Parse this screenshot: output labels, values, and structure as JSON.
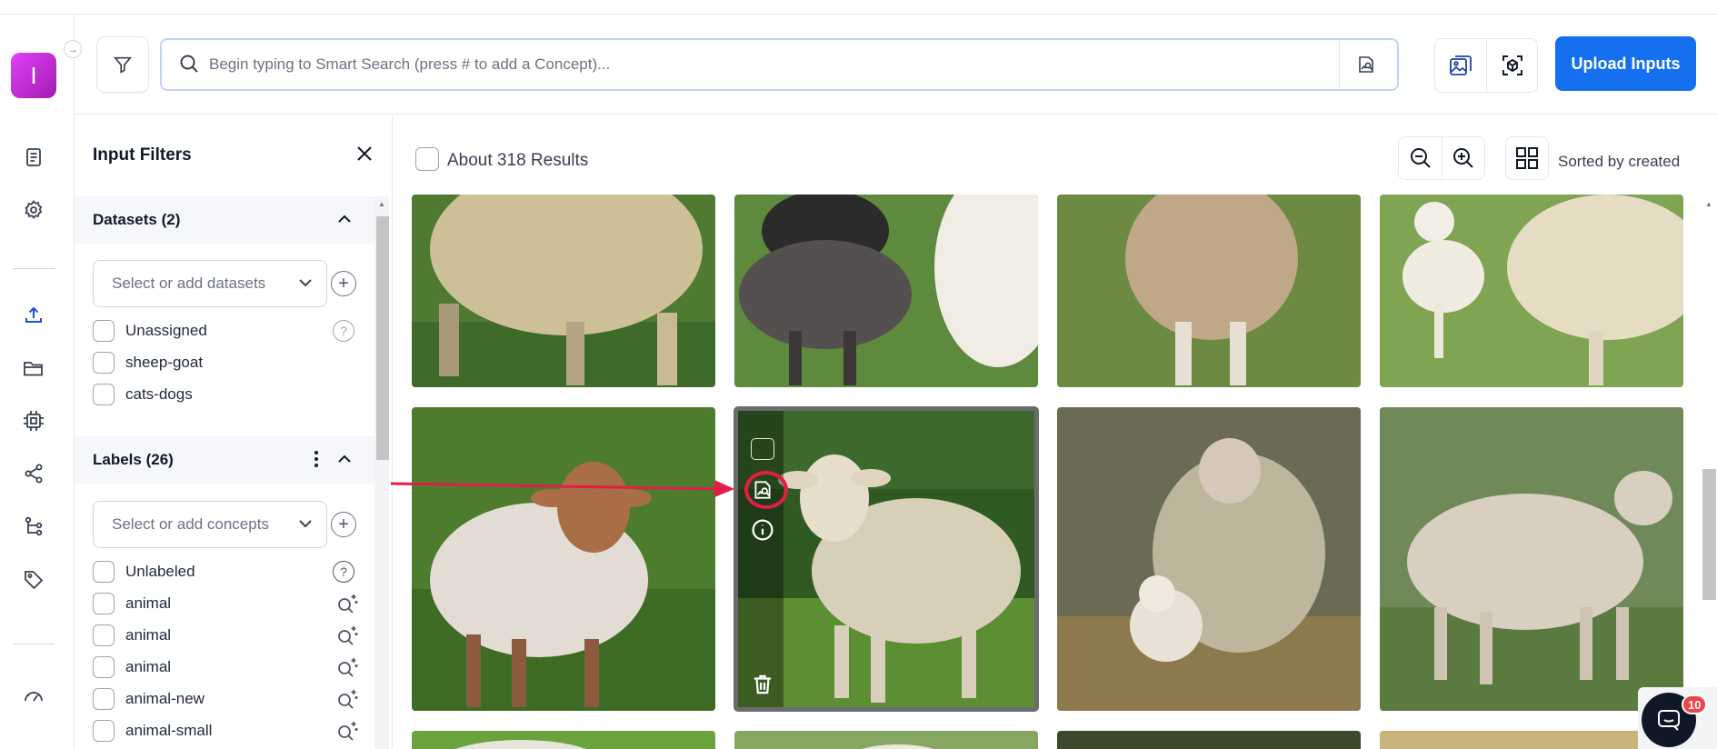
{
  "app": {
    "avatar_letter": "I",
    "accent_color": "#1570ef",
    "annotation_color": "#e11d48"
  },
  "rail": {
    "items": [
      {
        "name": "document-icon"
      },
      {
        "name": "settings-icon"
      },
      {
        "name": "upload-icon",
        "active": true
      },
      {
        "name": "folder-icon"
      },
      {
        "name": "chip-icon"
      },
      {
        "name": "share-icon"
      },
      {
        "name": "workflow-icon"
      },
      {
        "name": "tag-icon"
      },
      {
        "name": "gauge-icon"
      }
    ]
  },
  "header": {
    "search_placeholder": "Begin typing to Smart Search (press # to add a Concept)...",
    "upload_label": "Upload Inputs"
  },
  "filters": {
    "title": "Input Filters",
    "datasets": {
      "title": "Datasets (2)",
      "select_placeholder": "Select or add datasets",
      "items": [
        "Unassigned",
        "sheep-goat",
        "cats-dogs"
      ]
    },
    "labels": {
      "title": "Labels (26)",
      "select_placeholder": "Select or add concepts",
      "items": [
        "Unlabeled",
        "animal",
        "animal",
        "animal",
        "animal-new",
        "animal-small"
      ]
    }
  },
  "results": {
    "count_text": "About 318 Results",
    "sort_text": "Sorted by created"
  },
  "chat": {
    "badge": "10"
  }
}
